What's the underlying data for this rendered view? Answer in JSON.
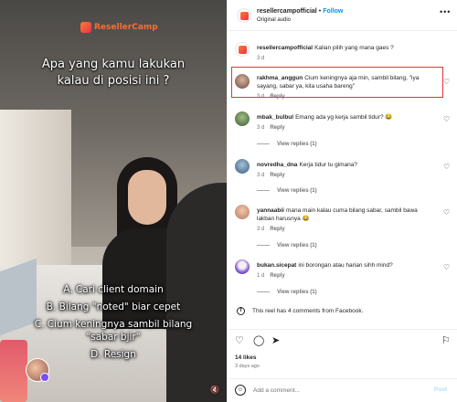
{
  "video": {
    "logo_text_1": "Reseller",
    "logo_text_2": "Camp",
    "headline": [
      "Apa yang kamu lakukan",
      "kalau di posisi ini ?"
    ],
    "options": [
      "A. Cari client domain",
      "B. Bilang \"noted\" biar cepet",
      "C. Cium keningnya sambil bilang",
      "\"sabar bjir\"",
      "D. Resign"
    ],
    "mute_icon": "speaker-muted-icon"
  },
  "header": {
    "username": "resellercampofficial",
    "separator": "•",
    "follow_label": "Follow",
    "audio_label": "Original audio",
    "more_icon": "more-horizontal-icon"
  },
  "caption": {
    "user": "resellercampofficial",
    "text": "Kalian pilih yang mana gaes ?",
    "time": "3 d"
  },
  "comments": [
    {
      "user": "rakhma_anggun",
      "text": "Cium keningnya aja min, sambil bilang, \"iya sayang, sabar ya, kita usaha bareng\"",
      "time": "3 d",
      "reply": "Reply",
      "view_replies": ""
    },
    {
      "user": "mbak_bulbul",
      "text": "Emang ada yg kerja sambil tidur? 😂",
      "time": "3 d",
      "reply": "Reply",
      "view_replies": "View replies (1)"
    },
    {
      "user": "novredha_dna",
      "text": "Kerja tidur tu gimana?",
      "time": "3 d",
      "reply": "Reply",
      "view_replies": "View replies (1)"
    },
    {
      "user": "yannaabii",
      "text": "mana main kalau cuma bilang sabar, sambil bawa lakban harusnya 😂",
      "time": "3 d",
      "reply": "Reply",
      "view_replies": "View replies (1)"
    },
    {
      "user": "bukan.sicepat",
      "text": "ini borongan atau harian sihh mind?",
      "time": "1 d",
      "reply": "Reply",
      "view_replies": "View replies (1)"
    }
  ],
  "facebook_note": "This reel has 4 comments from Facebook.",
  "actions": {
    "like_icon": "heart-icon",
    "comment_icon": "comment-icon",
    "share_icon": "send-icon",
    "save_icon": "bookmark-icon"
  },
  "likes": "14 likes",
  "date": "3 days ago",
  "add_comment": {
    "placeholder": "Add a comment...",
    "post_label": "Post"
  },
  "colors": {
    "accent": "#0095f6",
    "highlight": "#e8323a",
    "brand": "#ff6a33"
  }
}
